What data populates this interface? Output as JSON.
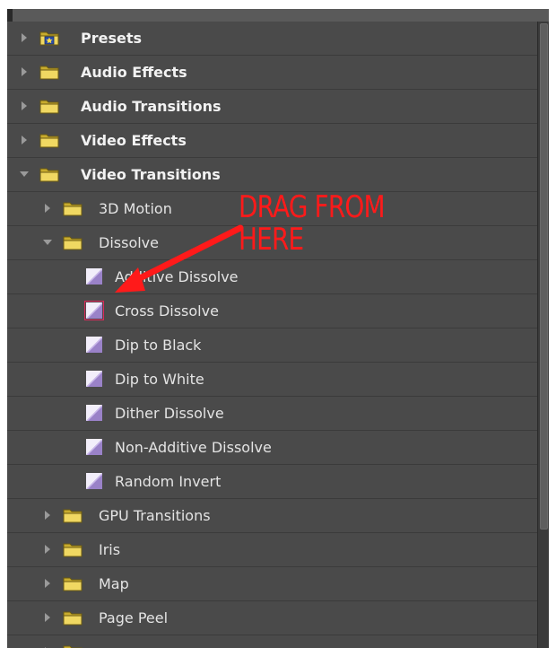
{
  "colors": {
    "panel_bg": "#4a4a4a",
    "row_border": "#3b3b3b",
    "text": "#e4e4e4",
    "folder_yellow": "#e8d05a",
    "transition_purple": "#a08ccc",
    "annotation_red": "#ff1a1a"
  },
  "tree": [
    {
      "label": "Presets",
      "level": 0,
      "expanded": false,
      "icon": "preset-folder-icon"
    },
    {
      "label": "Audio Effects",
      "level": 0,
      "expanded": false,
      "icon": "folder-icon"
    },
    {
      "label": "Audio Transitions",
      "level": 0,
      "expanded": false,
      "icon": "folder-icon"
    },
    {
      "label": "Video Effects",
      "level": 0,
      "expanded": false,
      "icon": "folder-icon"
    },
    {
      "label": "Video Transitions",
      "level": 0,
      "expanded": true,
      "icon": "folder-icon"
    },
    {
      "label": "3D Motion",
      "level": 1,
      "expanded": false,
      "icon": "folder-icon"
    },
    {
      "label": "Dissolve",
      "level": 1,
      "expanded": true,
      "icon": "folder-icon"
    },
    {
      "label": "Additive Dissolve",
      "level": 2,
      "icon": "transition-icon"
    },
    {
      "label": "Cross Dissolve",
      "level": 2,
      "icon": "transition-icon",
      "default": true
    },
    {
      "label": "Dip to Black",
      "level": 2,
      "icon": "transition-icon"
    },
    {
      "label": "Dip to White",
      "level": 2,
      "icon": "transition-icon"
    },
    {
      "label": "Dither Dissolve",
      "level": 2,
      "icon": "transition-icon"
    },
    {
      "label": "Non-Additive Dissolve",
      "level": 2,
      "icon": "transition-icon"
    },
    {
      "label": "Random Invert",
      "level": 2,
      "icon": "transition-icon"
    },
    {
      "label": "GPU Transitions",
      "level": 1,
      "expanded": false,
      "icon": "folder-icon"
    },
    {
      "label": "Iris",
      "level": 1,
      "expanded": false,
      "icon": "folder-icon"
    },
    {
      "label": "Map",
      "level": 1,
      "expanded": false,
      "icon": "folder-icon"
    },
    {
      "label": "Page Peel",
      "level": 1,
      "expanded": false,
      "icon": "folder-icon"
    },
    {
      "label": "",
      "level": 1,
      "expanded": false,
      "icon": "folder-icon"
    }
  ],
  "annotation": {
    "line1": "DRAG FROM",
    "line2": "HERE"
  }
}
